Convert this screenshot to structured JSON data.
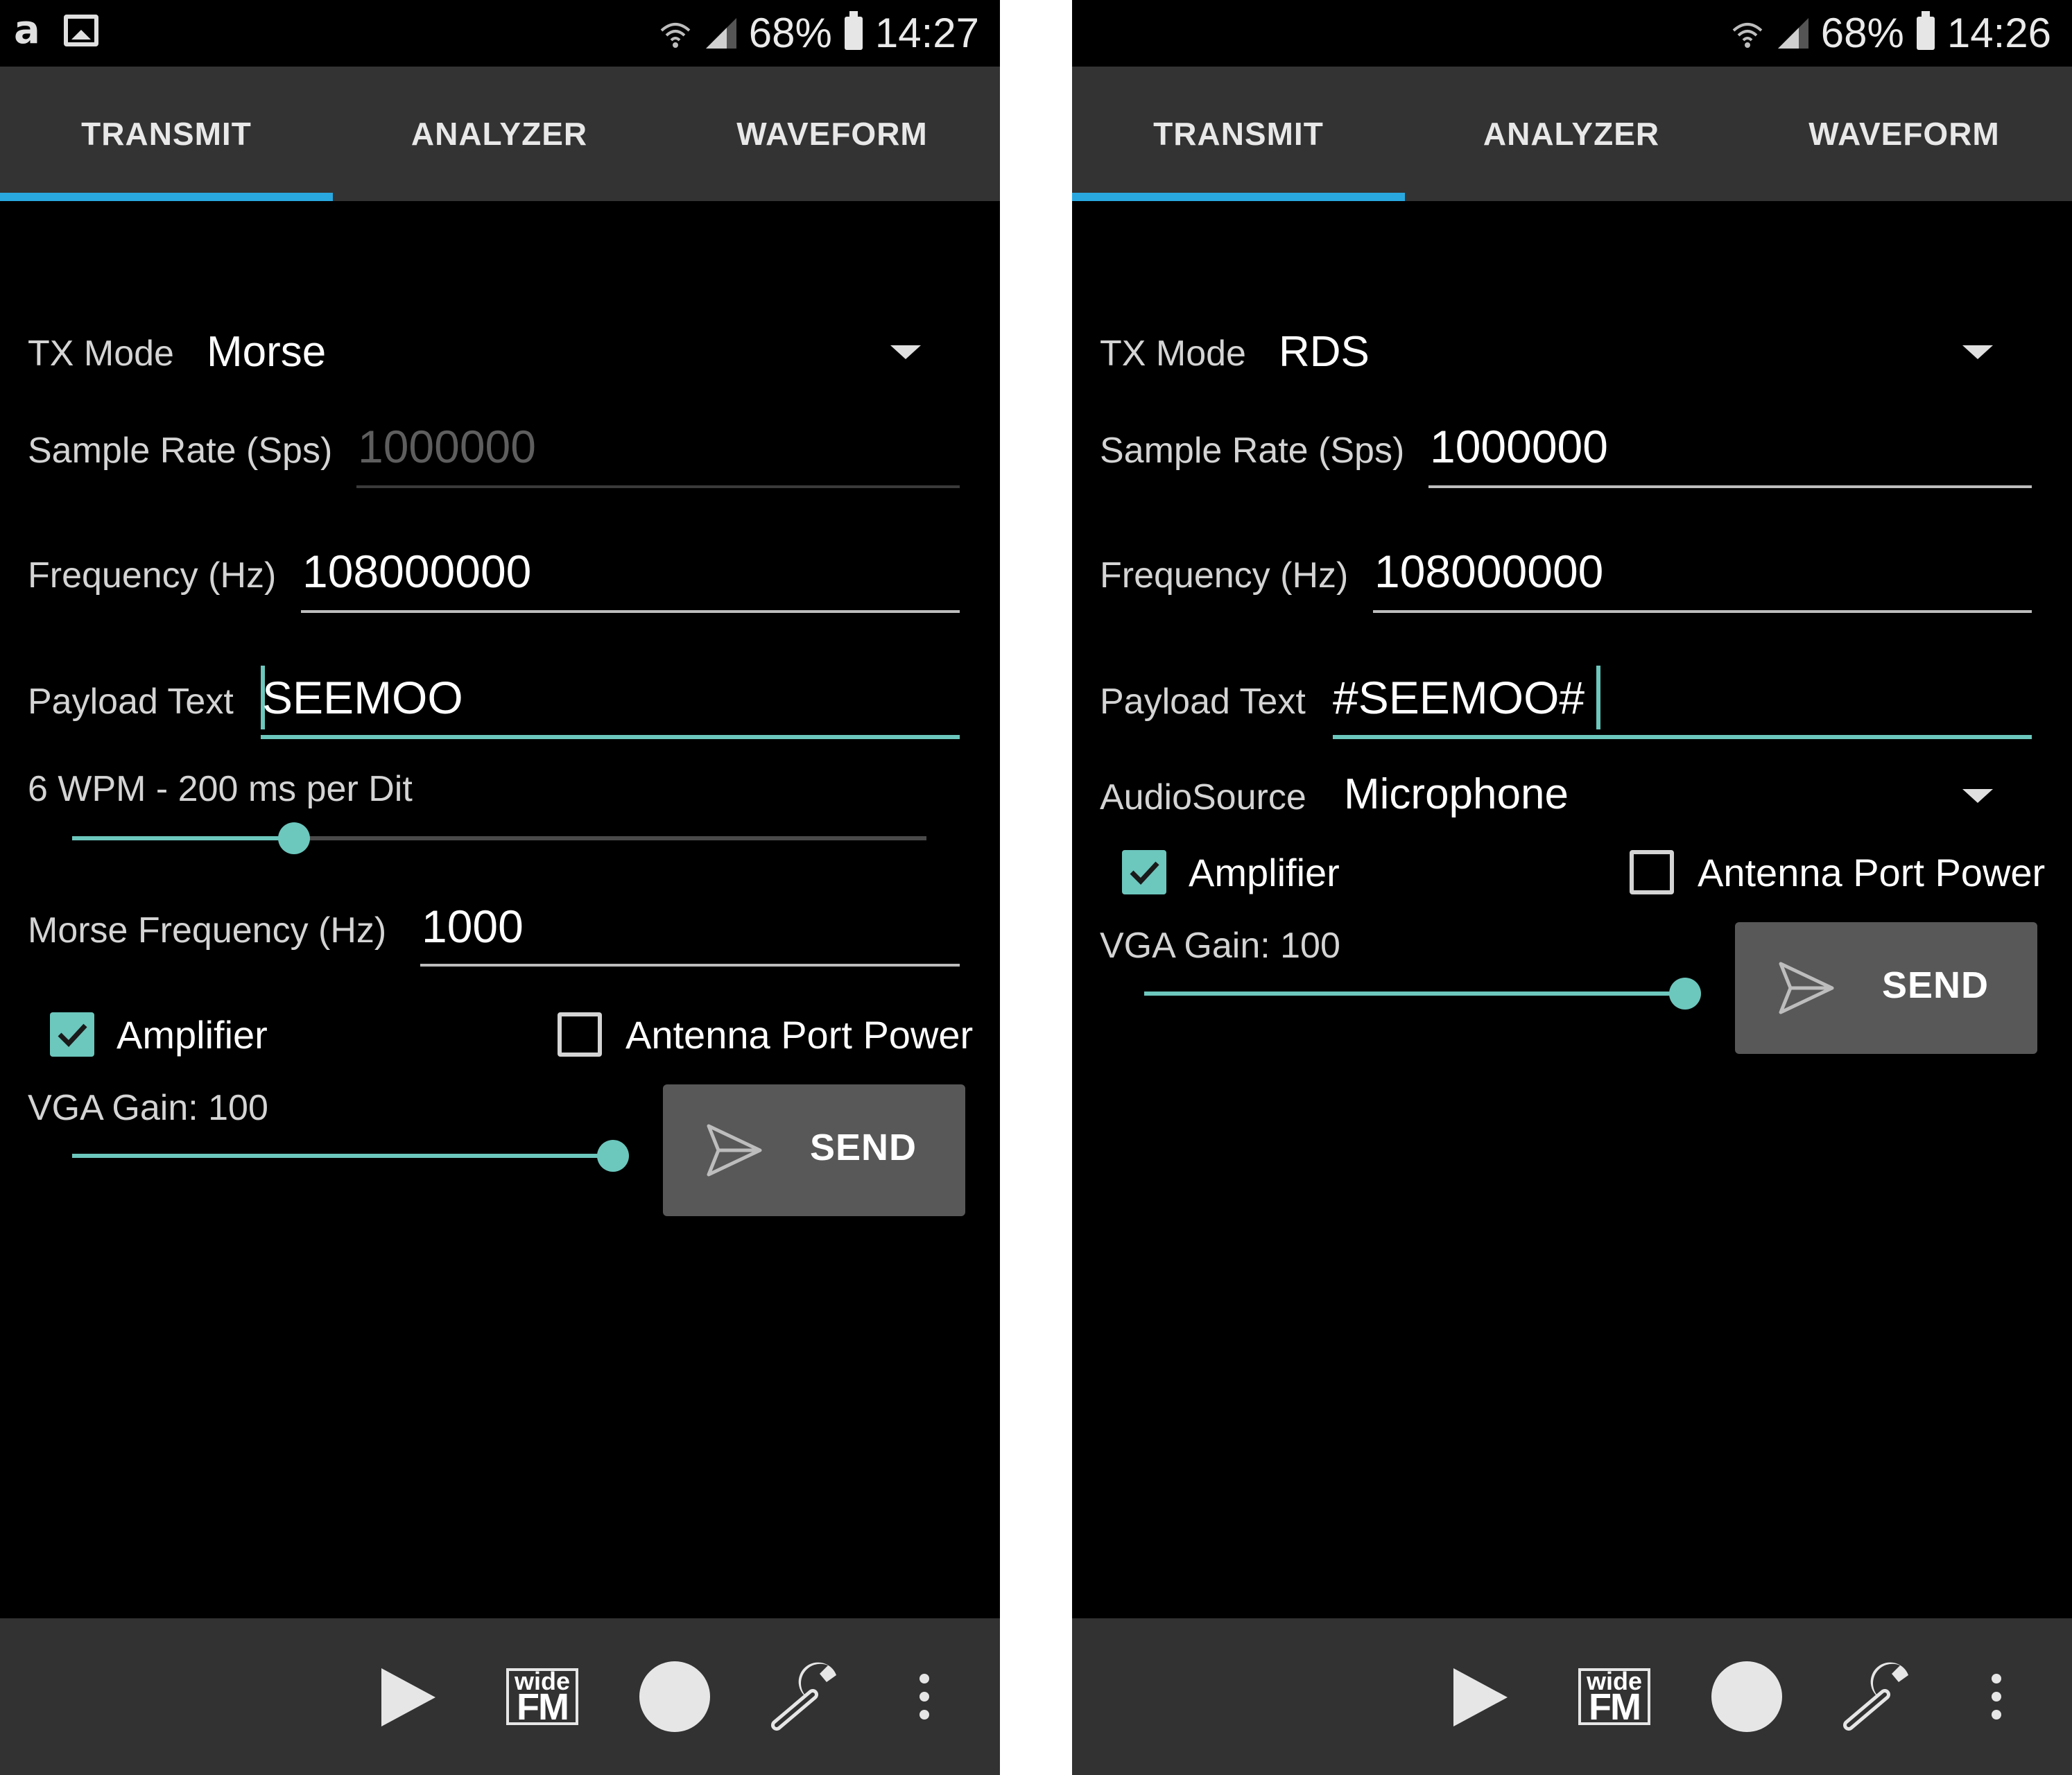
{
  "left": {
    "status": {
      "battery": "68%",
      "time": "14:27",
      "left_icons": [
        "amazon-icon",
        "image-icon"
      ]
    },
    "tabs": [
      "TRANSMIT",
      "ANALYZER",
      "WAVEFORM"
    ],
    "tx_mode": {
      "label": "TX Mode",
      "value": "Morse"
    },
    "sample_rate": {
      "label": "Sample Rate (Sps)",
      "value": "1000000"
    },
    "frequency": {
      "label": "Frequency (Hz)",
      "value": "108000000"
    },
    "payload": {
      "label": "Payload Text",
      "value": "SEEMOO"
    },
    "wpm": {
      "label": "6 WPM - 200 ms per Dit",
      "level": 0.26
    },
    "morse_freq": {
      "label": "Morse Frequency (Hz)",
      "value": "1000"
    },
    "amplifier": {
      "label": "Amplifier",
      "checked": true
    },
    "antenna": {
      "label": "Antenna Port Power",
      "checked": false
    },
    "vga": {
      "label": "VGA Gain: 100",
      "level": 1.0
    },
    "send": {
      "label": "SEND"
    },
    "bottom": {
      "widefm_top": "wide",
      "widefm_bottom": "FM"
    }
  },
  "right": {
    "status": {
      "battery": "68%",
      "time": "14:26"
    },
    "tabs": [
      "TRANSMIT",
      "ANALYZER",
      "WAVEFORM"
    ],
    "tx_mode": {
      "label": "TX Mode",
      "value": "RDS"
    },
    "sample_rate": {
      "label": "Sample Rate (Sps)",
      "value": "1000000"
    },
    "frequency": {
      "label": "Frequency (Hz)",
      "value": "108000000"
    },
    "payload": {
      "label": "Payload Text",
      "value": "#SEEMOO#"
    },
    "audio_source": {
      "label": "AudioSource",
      "value": "Microphone"
    },
    "amplifier": {
      "label": "Amplifier",
      "checked": true
    },
    "antenna": {
      "label": "Antenna Port Power",
      "checked": false
    },
    "vga": {
      "label": "VGA Gain: 100",
      "level": 1.0
    },
    "send": {
      "label": "SEND"
    },
    "bottom": {
      "widefm_top": "wide",
      "widefm_bottom": "FM"
    }
  },
  "colors": {
    "accent": "#6cc7bd",
    "tab_indicator": "#29a8e0",
    "tabbar": "#333333",
    "bottombar": "#323232",
    "button": "#585858"
  }
}
